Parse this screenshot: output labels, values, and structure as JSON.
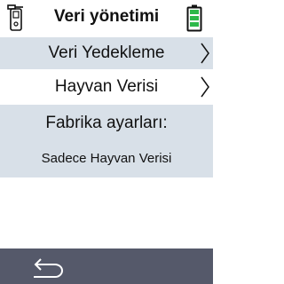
{
  "header": {
    "title": "Veri yönetimi",
    "left_icon": "device-icon",
    "right_icon": "battery-icon"
  },
  "menu": {
    "items": [
      {
        "label": "Veri Yedekleme",
        "icon": "chevron-right-icon"
      },
      {
        "label": "Hayvan Verisi",
        "icon": "chevron-right-icon"
      }
    ],
    "factory": {
      "heading": "Fabrika ayarları:",
      "option": "Sadece Hayvan Verisi"
    }
  },
  "footer": {
    "back_icon": "back-arrow-icon"
  },
  "colors": {
    "row_highlight": "#d8e0e8",
    "footer_bg": "#55596a",
    "battery_green": "#2db84a"
  }
}
